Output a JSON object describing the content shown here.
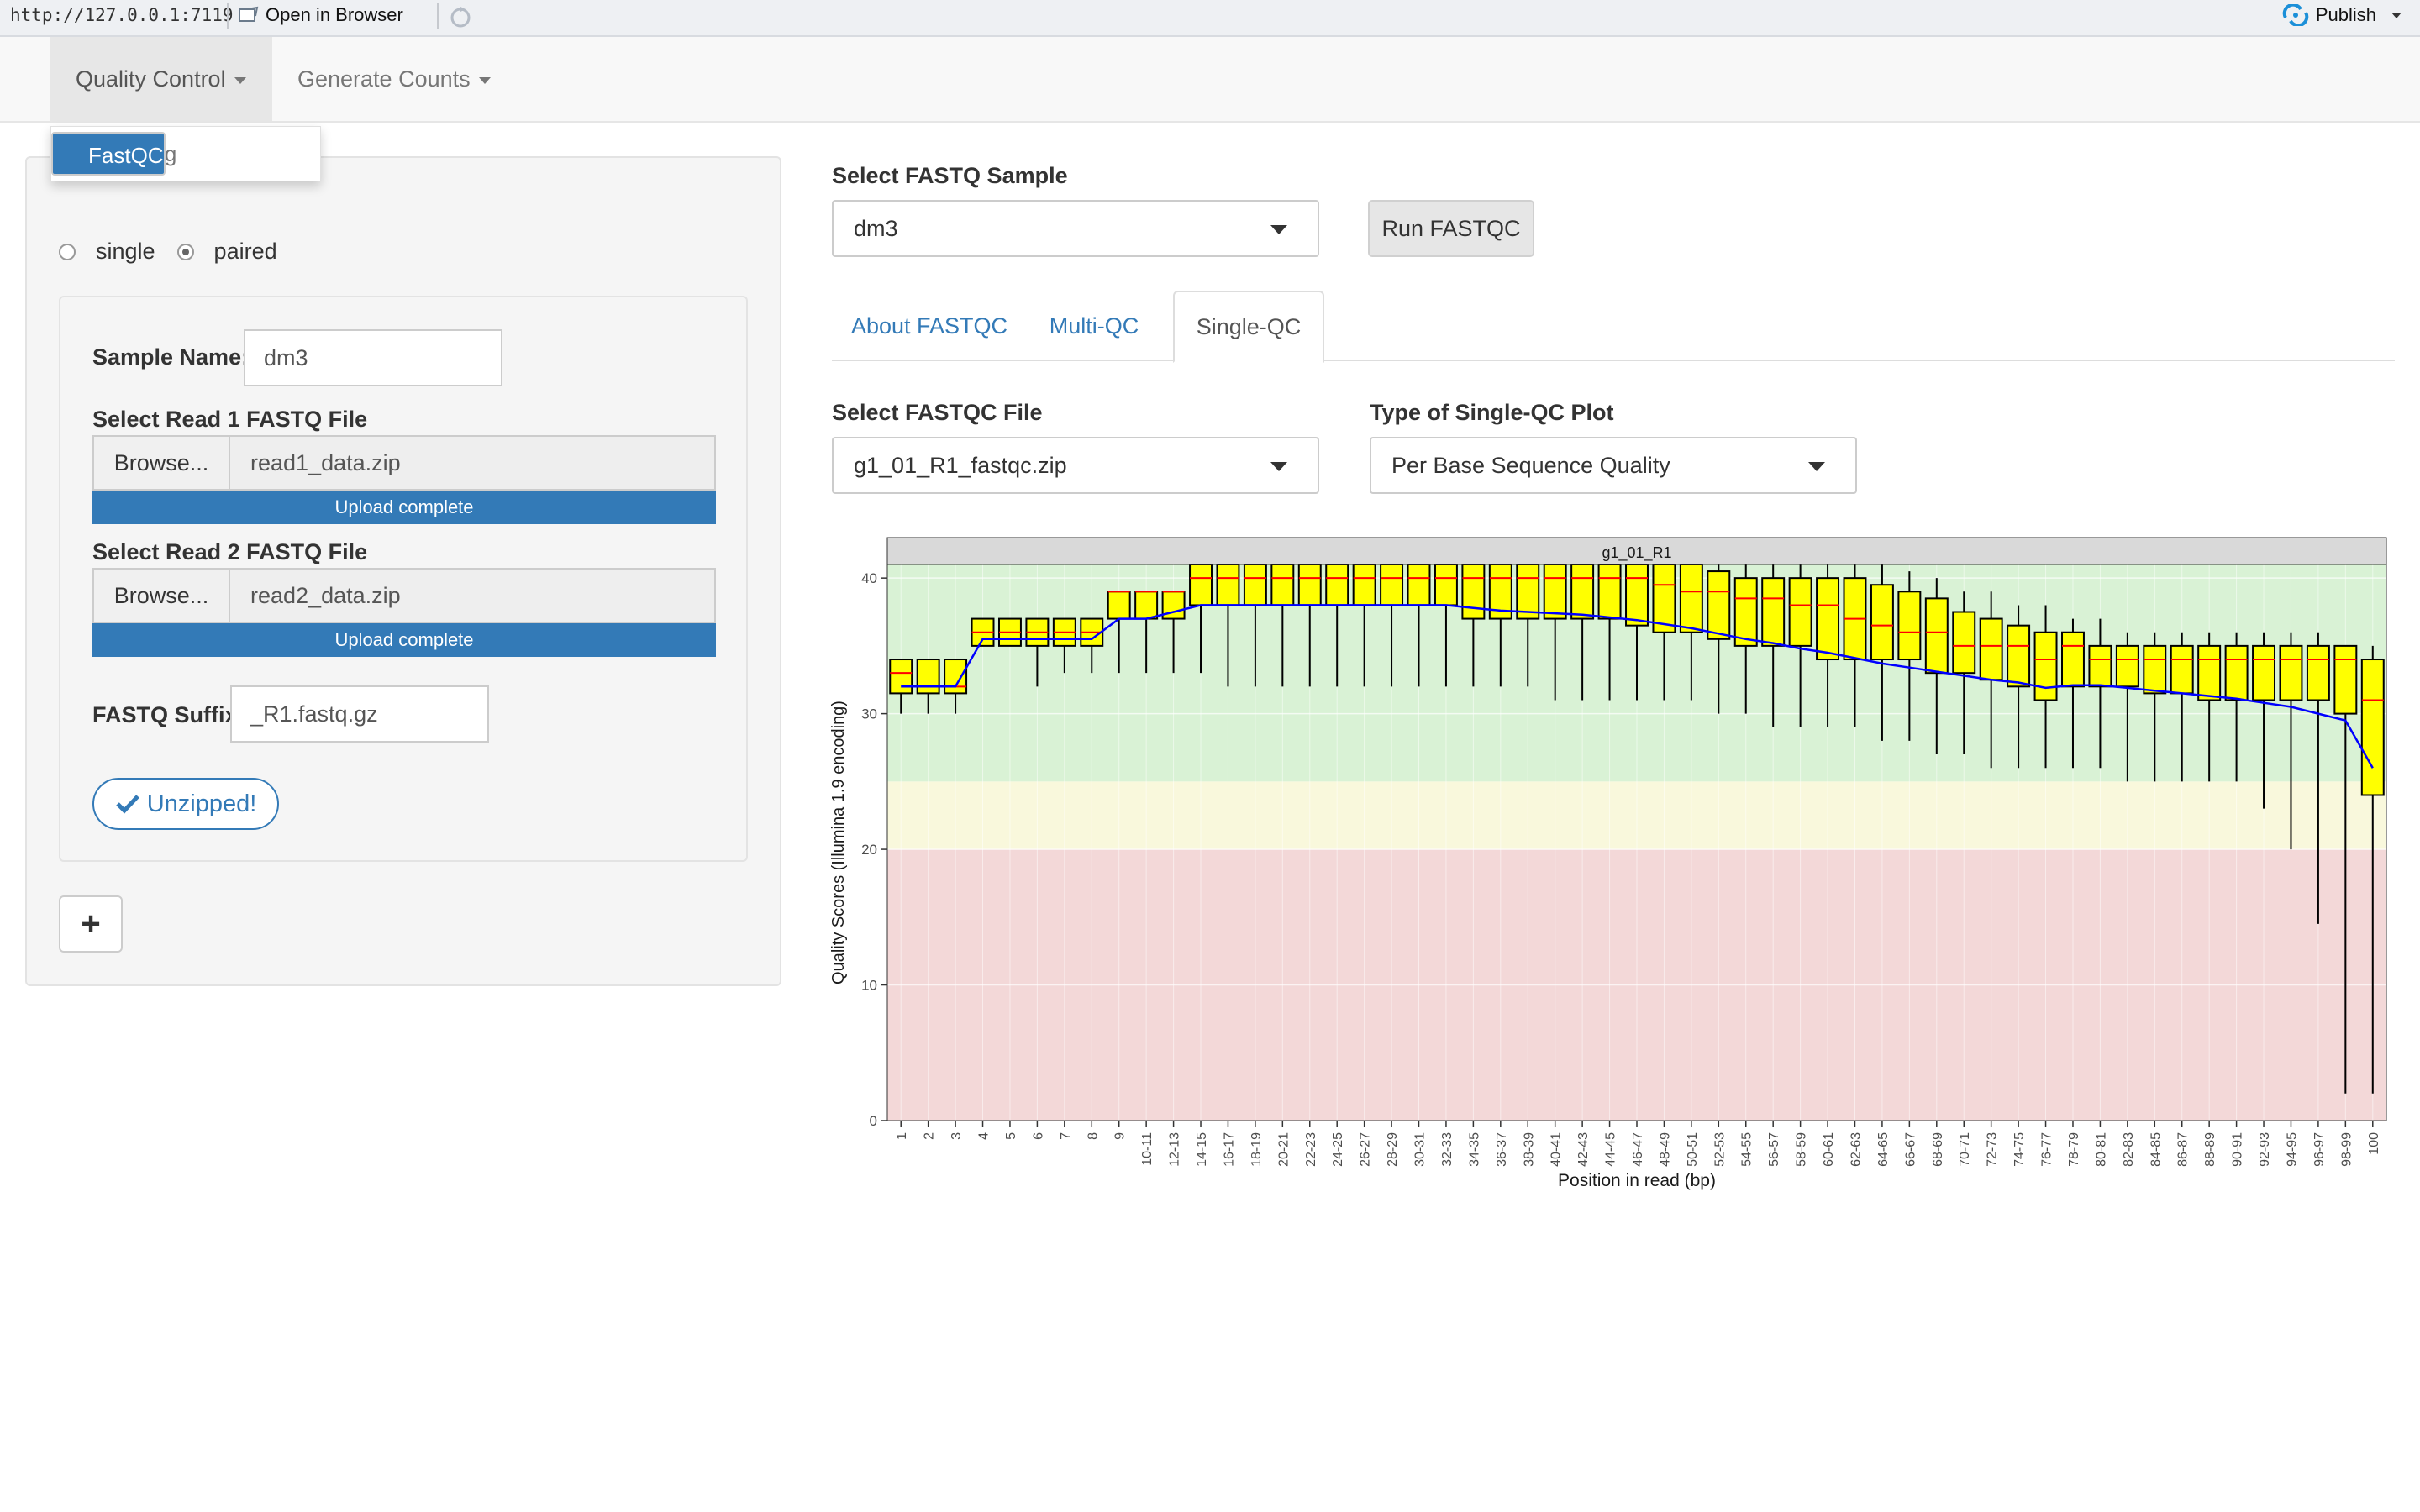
{
  "viewer": {
    "url": "http://127.0.0.1:7119",
    "open_in_browser": "Open in Browser",
    "publish": "Publish"
  },
  "navbar": {
    "items": [
      {
        "label": "Quality Control"
      },
      {
        "label": "Generate Counts"
      }
    ],
    "dropdown": [
      {
        "label": "FastQC",
        "selected": true
      },
      {
        "label": "Trimming",
        "selected": false
      }
    ]
  },
  "sidebar": {
    "read_type_options": [
      {
        "label": "single",
        "checked": false
      },
      {
        "label": "paired",
        "checked": true
      }
    ],
    "sample_name_label": "Sample Name:",
    "sample_name_value": "dm3",
    "read1_label": "Select Read 1 FASTQ File",
    "read1_browse": "Browse...",
    "read1_file": "read1_data.zip",
    "read1_progress": "Upload complete",
    "read2_label": "Select Read 2 FASTQ File",
    "read2_browse": "Browse...",
    "read2_file": "read2_data.zip",
    "read2_progress": "Upload complete",
    "suffix_label": "FASTQ Suffix:",
    "suffix_value": "_R1.fastq.gz",
    "unzipped_label": "Unzipped!",
    "add_label": "+"
  },
  "main": {
    "sample_select_label": "Select FASTQ Sample",
    "sample_select_value": "dm3",
    "run_button": "Run FASTQC",
    "tabs": [
      {
        "label": "About FASTQC",
        "active": false
      },
      {
        "label": "Multi-QC",
        "active": false
      },
      {
        "label": "Single-QC",
        "active": true
      }
    ],
    "file_select_label": "Select FASTQC File",
    "file_select_value": "g1_01_R1_fastqc.zip",
    "plot_type_label": "Type of Single-QC Plot",
    "plot_type_value": "Per Base Sequence Quality"
  },
  "colors": {
    "primary": "#337ab7",
    "box_fill": "#ffff00",
    "median": "#ff0000",
    "mean_line": "#0000ff",
    "zone_good": "#d9f2d5",
    "zone_warn": "#f9f8dc",
    "zone_bad": "#f3d8d8"
  },
  "chart_data": {
    "type": "box",
    "title": "g1_01_R1",
    "xlabel": "Position in read (bp)",
    "ylabel": "Quality Scores (Illumina 1.9 encoding)",
    "ylim": [
      0,
      41
    ],
    "yticks": [
      0,
      10,
      20,
      30,
      40
    ],
    "zones": [
      {
        "from": 0,
        "to": 20,
        "color": "bad"
      },
      {
        "from": 20,
        "to": 25,
        "color": "warn"
      },
      {
        "from": 25,
        "to": 41,
        "color": "good"
      }
    ],
    "categories": [
      "1",
      "2",
      "3",
      "4",
      "5",
      "6",
      "7",
      "8",
      "9",
      "10-11",
      "12-13",
      "14-15",
      "16-17",
      "18-19",
      "20-21",
      "22-23",
      "24-25",
      "26-27",
      "28-29",
      "30-31",
      "32-33",
      "34-35",
      "36-37",
      "38-39",
      "40-41",
      "42-43",
      "44-45",
      "46-47",
      "48-49",
      "50-51",
      "52-53",
      "54-55",
      "56-57",
      "58-59",
      "60-61",
      "62-63",
      "64-65",
      "66-67",
      "68-69",
      "70-71",
      "72-73",
      "74-75",
      "76-77",
      "78-79",
      "80-81",
      "82-83",
      "84-85",
      "86-87",
      "88-89",
      "90-91",
      "92-93",
      "94-95",
      "96-97",
      "98-99",
      "100"
    ],
    "series": [
      {
        "name": "whisker_low",
        "values": [
          30,
          30,
          30,
          35,
          35,
          32,
          33,
          33,
          33,
          33,
          33,
          33,
          32,
          32,
          32,
          32,
          32,
          32,
          32,
          32,
          32,
          32,
          32,
          32,
          31,
          31,
          31,
          31,
          31,
          31,
          30,
          30,
          29,
          29,
          29,
          29,
          28,
          28,
          27,
          27,
          26,
          26,
          26,
          26,
          26,
          25,
          25,
          25,
          25,
          25,
          23,
          20,
          14.5,
          2,
          2
        ]
      },
      {
        "name": "q1",
        "values": [
          31.5,
          31.5,
          31.5,
          35,
          35,
          35,
          35,
          35,
          37,
          37,
          37,
          38,
          38,
          38,
          38,
          38,
          38,
          38,
          38,
          38,
          38,
          37,
          37,
          37,
          37,
          37,
          37,
          36.5,
          36,
          36,
          35.5,
          35,
          35,
          35,
          34,
          34,
          34,
          34,
          33,
          33,
          32.5,
          32,
          31,
          32,
          32,
          32,
          31.5,
          31.5,
          31,
          31,
          31,
          31,
          31,
          30,
          24
        ]
      },
      {
        "name": "median",
        "values": [
          33,
          32,
          32,
          36,
          36,
          36,
          36,
          36,
          39,
          39,
          39,
          40,
          40,
          40,
          40,
          40,
          40,
          40,
          40,
          40,
          40,
          40,
          40,
          40,
          40,
          40,
          40,
          40,
          39.5,
          39,
          39,
          38.5,
          38.5,
          38,
          38,
          37,
          36.5,
          36,
          36,
          35,
          35,
          35,
          34,
          35,
          34,
          34,
          34,
          34,
          34,
          34,
          34,
          34,
          34,
          34,
          31
        ]
      },
      {
        "name": "q3",
        "values": [
          34,
          34,
          34,
          37,
          37,
          37,
          37,
          37,
          39,
          39,
          39,
          41,
          41,
          41,
          41,
          41,
          41,
          41,
          41,
          41,
          41,
          41,
          41,
          41,
          41,
          41,
          41,
          41,
          41,
          41,
          40.5,
          40,
          40,
          40,
          40,
          40,
          39.5,
          39,
          38.5,
          37.5,
          37,
          36.5,
          36,
          36,
          35,
          35,
          35,
          35,
          35,
          35,
          35,
          35,
          35,
          35,
          34
        ]
      },
      {
        "name": "whisker_high",
        "values": [
          34,
          34,
          34,
          37,
          37,
          37,
          37,
          37,
          39,
          39,
          39,
          41,
          41,
          41,
          41,
          41,
          41,
          41,
          41,
          41,
          41,
          41,
          41,
          41,
          41,
          41,
          41,
          41,
          41,
          41,
          41,
          41,
          41,
          41,
          41,
          41,
          41,
          40.5,
          40,
          39,
          39,
          38,
          38,
          37,
          37,
          36,
          36,
          36,
          36,
          36,
          36,
          36,
          36,
          35,
          35
        ]
      },
      {
        "name": "mean",
        "values": [
          32,
          32,
          32,
          35.5,
          35.5,
          35.5,
          35.5,
          35.5,
          37,
          37,
          37.5,
          38,
          38,
          38,
          38,
          38,
          38,
          38,
          38,
          38,
          38,
          37.8,
          37.6,
          37.5,
          37.4,
          37.3,
          37.1,
          36.9,
          36.6,
          36.3,
          35.9,
          35.5,
          35.2,
          34.8,
          34.5,
          34.1,
          33.7,
          33.4,
          33.1,
          32.8,
          32.5,
          32.3,
          31.9,
          32.1,
          32.1,
          31.9,
          31.7,
          31.5,
          31.3,
          31.1,
          30.8,
          30.5,
          30,
          29.5,
          26
        ]
      }
    ]
  }
}
